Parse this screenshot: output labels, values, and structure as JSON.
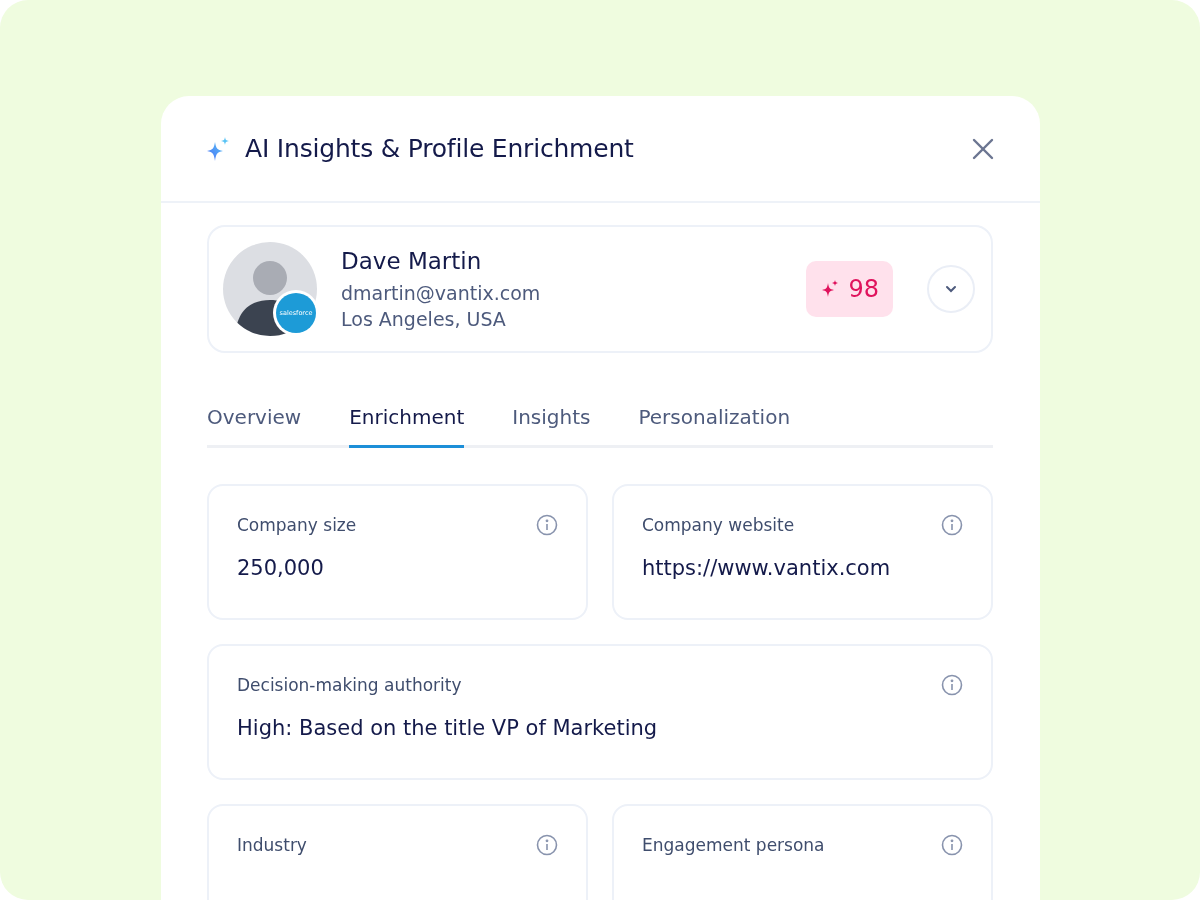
{
  "dialog": {
    "title": "AI Insights & Profile Enrichment"
  },
  "profile": {
    "name": "Dave Martin",
    "email": "dmartin@vantix.com",
    "location": "Los Angeles, USA",
    "crm_badge": "salesforce",
    "score": "98",
    "expanded": false
  },
  "tabs": [
    {
      "label": "Overview",
      "selected": false
    },
    {
      "label": "Enrichment",
      "selected": true
    },
    {
      "label": "Insights",
      "selected": false
    },
    {
      "label": "Personalization",
      "selected": false
    }
  ],
  "fields": [
    {
      "label": "Company size",
      "value": "250,000",
      "wide": false
    },
    {
      "label": "Company website",
      "value": "https://www.vantix.com",
      "wide": false
    },
    {
      "label": "Decision-making authority",
      "value": "High: Based on the title VP of Marketing",
      "wide": true
    },
    {
      "label": "Industry",
      "wide": false
    },
    {
      "label": "Engagement persona",
      "wide": false
    }
  ]
}
